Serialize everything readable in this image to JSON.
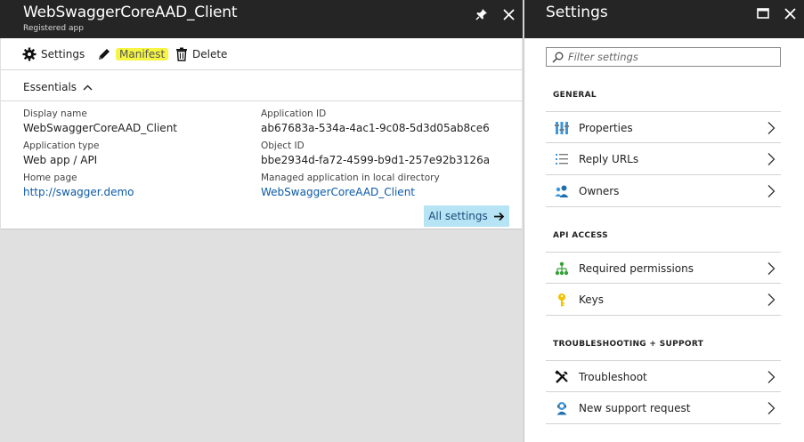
{
  "left_blade": {
    "title": "WebSwaggerCoreAAD_Client",
    "subtitle": "Registered app",
    "toolbar": {
      "settings_label": "Settings",
      "manifest_label": "Manifest",
      "delete_label": "Delete"
    },
    "essentials_label": "Essentials",
    "properties": {
      "display_name_label": "Display name",
      "display_name_value": "WebSwaggerCoreAAD_Client",
      "application_type_label": "Application type",
      "application_type_value": "Web app / API",
      "home_page_label": "Home page",
      "home_page_value": "http://swagger.demo",
      "application_id_label": "Application ID",
      "application_id_value": "ab67683a-534a-4ac1-9c08-5d3d05ab8ce6",
      "object_id_label": "Object ID",
      "object_id_value": "bbe2934d-fa72-4599-b9d1-257e92b3126a",
      "managed_app_label": "Managed application in local directory",
      "managed_app_value": "WebSwaggerCoreAAD_Client"
    },
    "all_settings_label": "All settings"
  },
  "right_blade": {
    "title": "Settings",
    "filter_placeholder": "Filter settings",
    "sections": {
      "general": {
        "header": "GENERAL",
        "items": [
          {
            "label": "Properties",
            "icon": "properties-icon"
          },
          {
            "label": "Reply URLs",
            "icon": "reply-urls-icon"
          },
          {
            "label": "Owners",
            "icon": "owners-icon"
          }
        ]
      },
      "api_access": {
        "header": "API ACCESS",
        "items": [
          {
            "label": "Required permissions",
            "icon": "permissions-icon"
          },
          {
            "label": "Keys",
            "icon": "key-icon"
          }
        ]
      },
      "troubleshooting": {
        "header": "TROUBLESHOOTING + SUPPORT",
        "items": [
          {
            "label": "Troubleshoot",
            "icon": "troubleshoot-icon"
          },
          {
            "label": "New support request",
            "icon": "support-request-icon"
          }
        ]
      }
    }
  },
  "colors": {
    "header_bg": "#252525",
    "link": "#0b5aa8",
    "highlight": "#f5f542",
    "all_settings_bg": "#b7e4f4",
    "icon_blue": "#3a96dd",
    "icon_green": "#3aa13a",
    "icon_yellow": "#f3c200"
  }
}
